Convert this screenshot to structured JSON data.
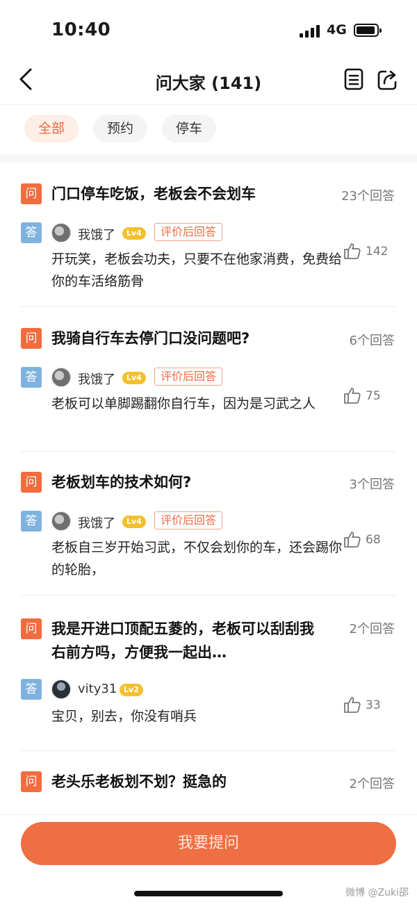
{
  "status_bar": {
    "time": "10:40",
    "network": "4G"
  },
  "nav": {
    "title": "问大家 (141)",
    "back_icon": "chevron-left-icon",
    "icons": [
      "list-document-icon",
      "share-icon"
    ]
  },
  "tabs": [
    {
      "label": "全部",
      "active": true
    },
    {
      "label": "预约",
      "active": false
    },
    {
      "label": "停车",
      "active": false
    }
  ],
  "badges": {
    "question": "问",
    "answer": "答"
  },
  "questions": [
    {
      "title": "门口停车吃饭，老板会不会划车",
      "answers_count": "23个回答",
      "answer": {
        "user": "我饿了",
        "level": "Lv4",
        "tag": "评价后回答",
        "text": "开玩笑，老板会功夫，只要不在他家消费，免费给你的车活络筋骨",
        "likes": "142"
      }
    },
    {
      "title": "我骑自行车去停门口没问题吧?",
      "answers_count": "6个回答",
      "answer": {
        "user": "我饿了",
        "level": "Lv4",
        "tag": "评价后回答",
        "text": "老板可以单脚踢翻你自行车，因为是习武之人",
        "likes": "75"
      }
    },
    {
      "title": "老板划车的技术如何?",
      "answers_count": "3个回答",
      "answer": {
        "user": "我饿了",
        "level": "Lv4",
        "tag": "评价后回答",
        "text": "老板自三岁开始习武，不仅会划你的车，还会踢你的轮胎，",
        "likes": "68"
      }
    },
    {
      "title": "我是开进口顶配五菱的，老板可以刮刮我右前方吗，方便我一起出…",
      "answers_count": "2个回答",
      "answer": {
        "user": "vity31",
        "level": "Lv2",
        "tag": "",
        "text": "宝贝，别去，你没有哨兵",
        "likes": "33"
      }
    },
    {
      "title": "老头乐老板划不划？挺急的",
      "answers_count": "2个回答"
    }
  ],
  "bottom": {
    "ask_button": "我要提问",
    "watermark": "微博 @Zuki邵"
  },
  "colors": {
    "accent": "#ee6f43",
    "answer_badge": "#7fb3df",
    "level_badge": "#f3c02e"
  }
}
